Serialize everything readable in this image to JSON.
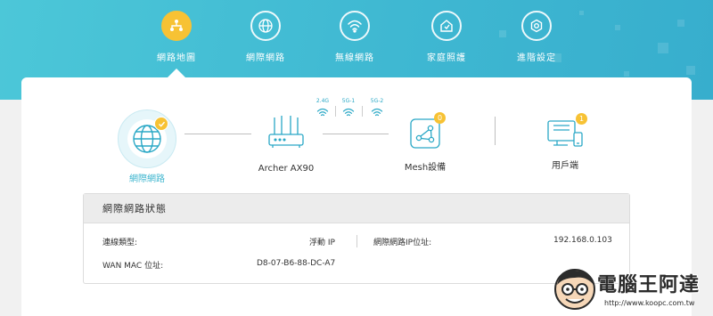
{
  "nav": {
    "items": [
      {
        "label": "網路地圖",
        "icon": "network-map-icon",
        "active": true
      },
      {
        "label": "網際網路",
        "icon": "globe-icon",
        "active": false
      },
      {
        "label": "無線網路",
        "icon": "wifi-icon",
        "active": false
      },
      {
        "label": "家庭照護",
        "icon": "home-care-icon",
        "active": false
      },
      {
        "label": "進階設定",
        "icon": "gear-icon",
        "active": false
      }
    ]
  },
  "topology": {
    "internet": {
      "label": "網際網路",
      "status": "connected"
    },
    "router": {
      "label": "Archer AX90"
    },
    "bands": [
      "2.4G",
      "5G-1",
      "5G-2"
    ],
    "mesh": {
      "label": "Mesh設備",
      "count": "0"
    },
    "clients": {
      "label": "用戶端",
      "count": "1"
    }
  },
  "status": {
    "title": "網際網路狀態",
    "connection_type_label": "連線類型:",
    "connection_type_value": "浮動 IP",
    "ip_label": "網際網路IP位址:",
    "ip_value": "192.168.0.103",
    "mac_label": "WAN MAC 位址:",
    "mac_value": "D8-07-B6-88-DC-A7"
  },
  "watermark": {
    "text": "電腦王阿達",
    "url": "http://www.koopc.com.tw"
  },
  "colors": {
    "header": "#3fb8d2",
    "accent": "#3fb6cf",
    "badge": "#f7c234"
  }
}
